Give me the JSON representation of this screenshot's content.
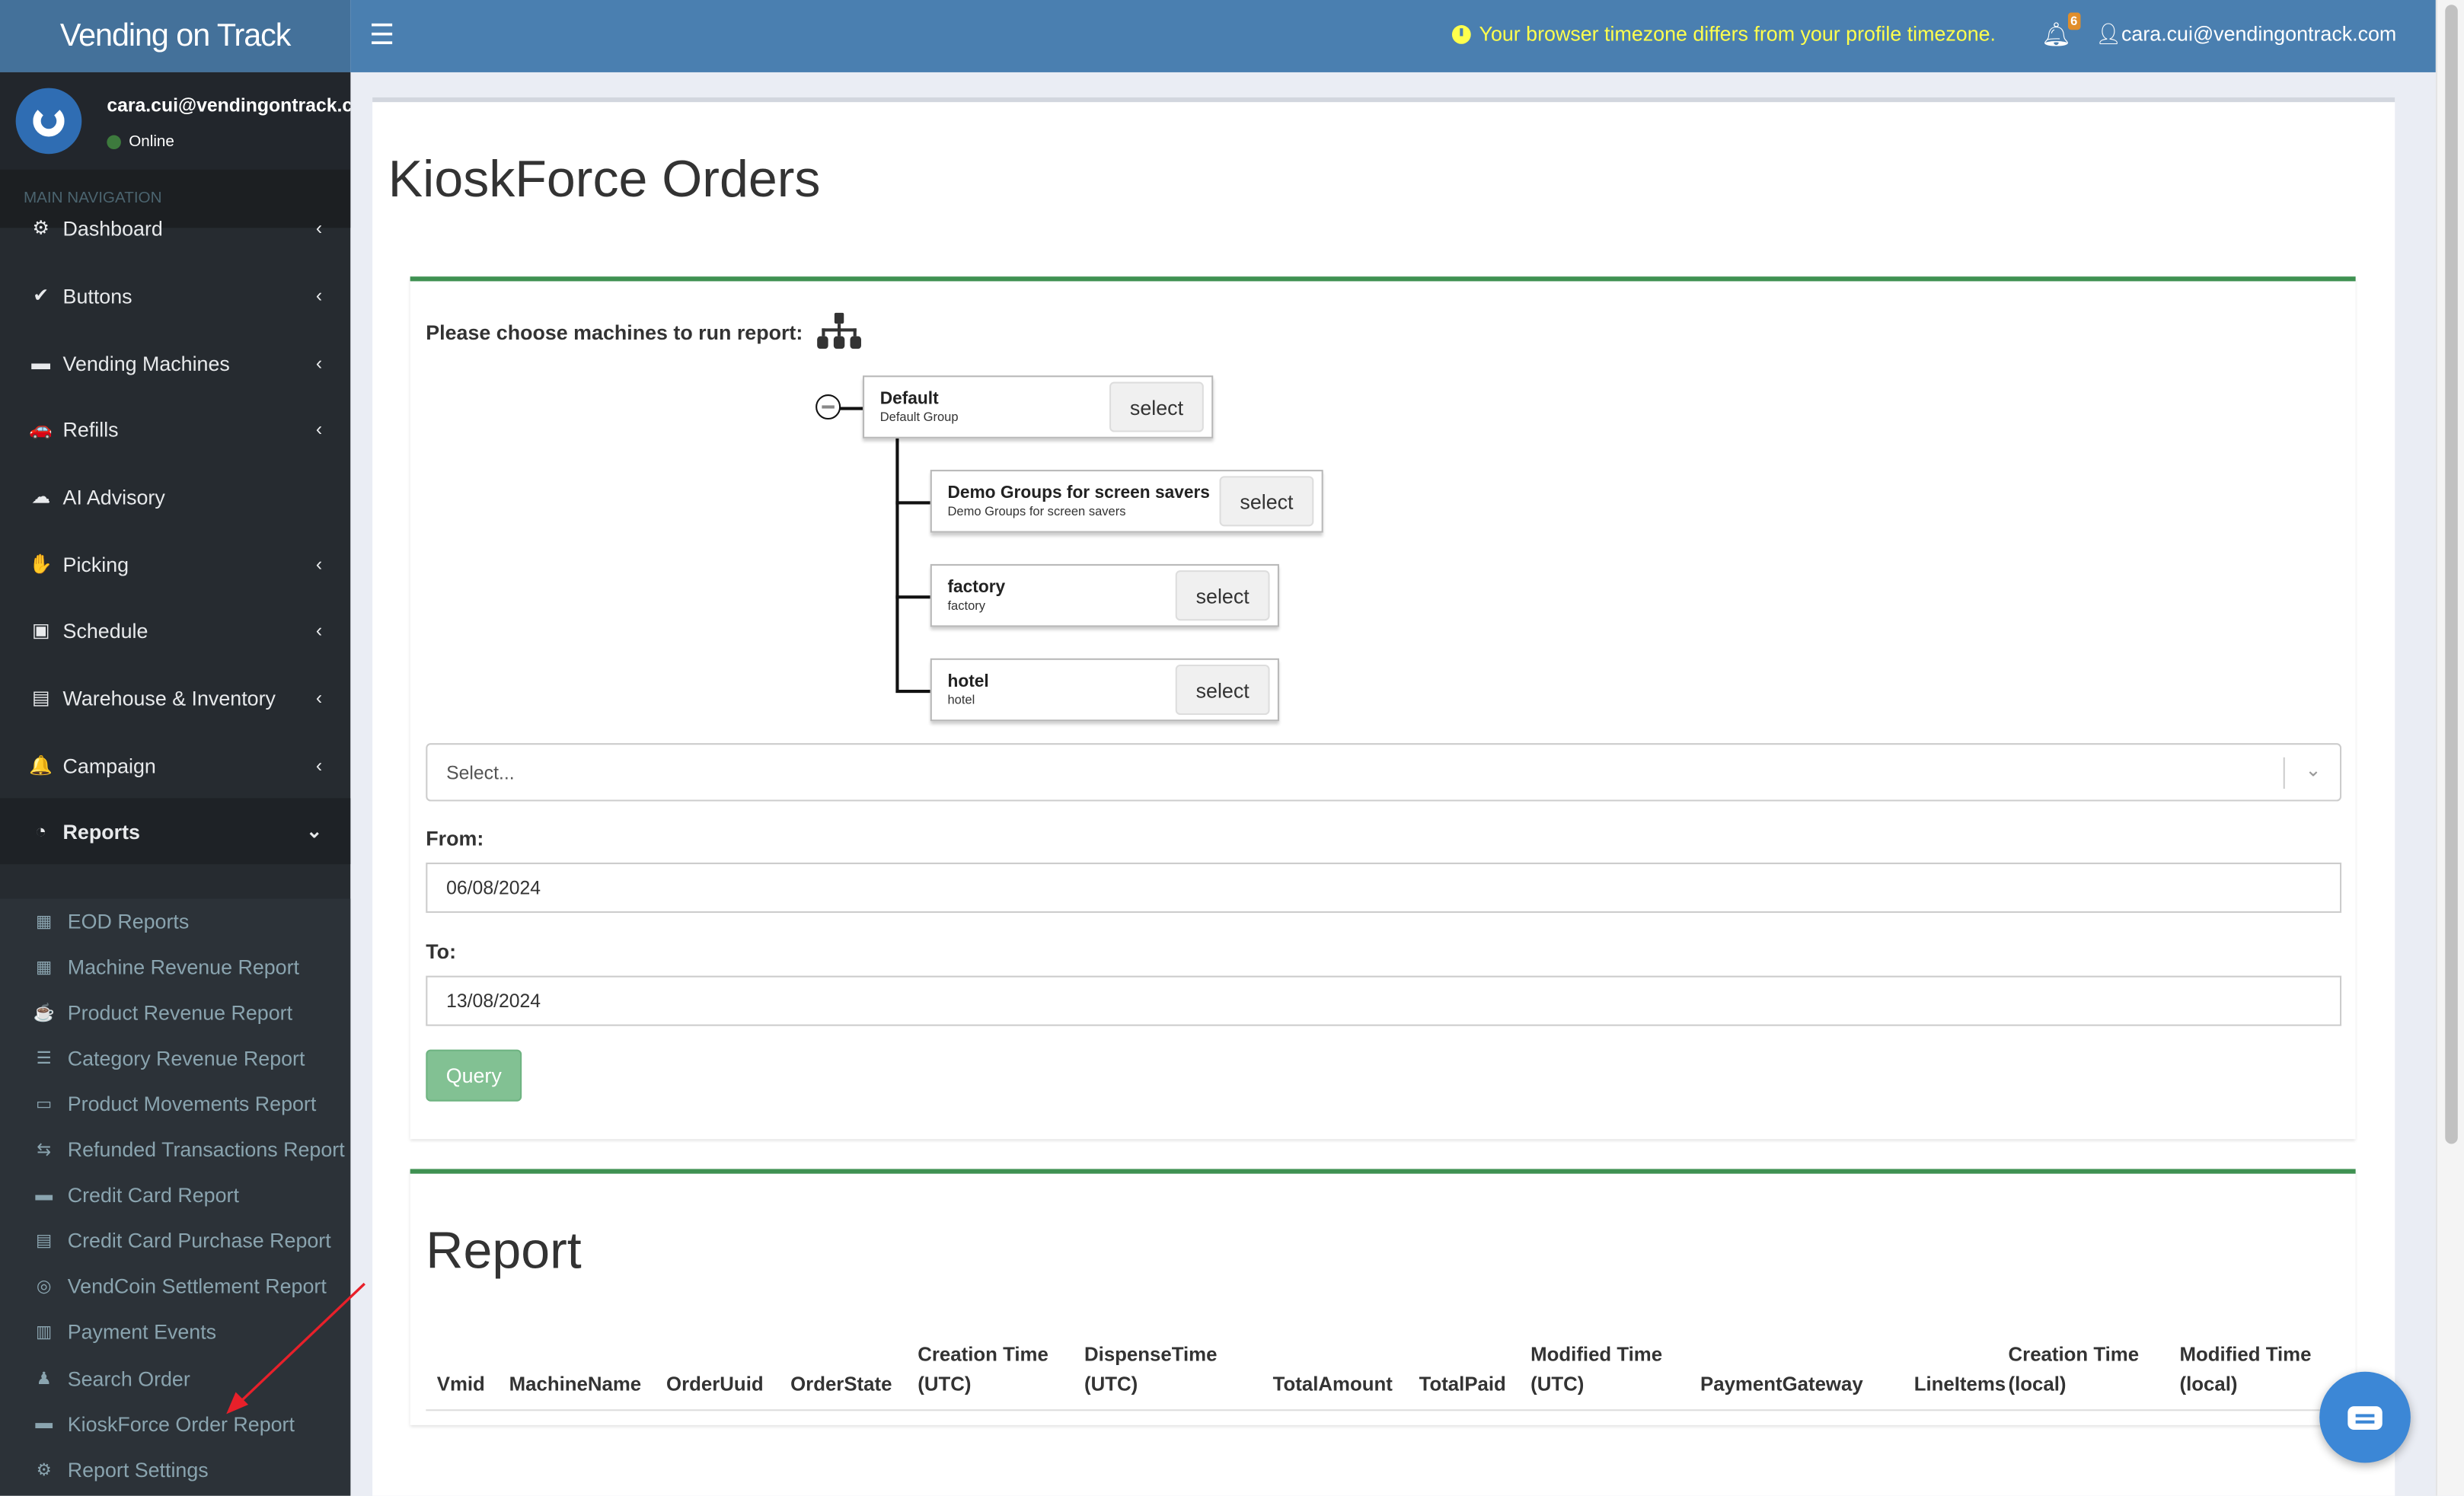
{
  "app": {
    "title": "Vending on Track"
  },
  "header": {
    "tz_warning": "Your browser timezone differs from your profile timezone.",
    "notif_count": "6",
    "user": "cara.cui@vendingontrack.com"
  },
  "user_panel": {
    "name": "cara.cui@vendingontrack.com",
    "status": "Online"
  },
  "sidebar": {
    "header": "MAIN NAVIGATION",
    "items": [
      {
        "label": "Dashboard",
        "icon": "⚙"
      },
      {
        "label": "Buttons",
        "icon": "✔"
      },
      {
        "label": "Vending Machines",
        "icon": "▬"
      },
      {
        "label": "Refills",
        "icon": "🚗"
      },
      {
        "label": "AI Advisory",
        "icon": "☁"
      },
      {
        "label": "Picking",
        "icon": "✋"
      },
      {
        "label": "Schedule",
        "icon": "▣"
      },
      {
        "label": "Warehouse & Inventory",
        "icon": "▤"
      },
      {
        "label": "Campaign",
        "icon": "🔔"
      },
      {
        "label": "Reports",
        "icon": "◔"
      }
    ],
    "report_items": [
      {
        "label": "EOD Reports",
        "icon": "▦"
      },
      {
        "label": "Machine Revenue Report",
        "icon": "▦"
      },
      {
        "label": "Product Revenue Report",
        "icon": "☕"
      },
      {
        "label": "Category Revenue Report",
        "icon": "☰"
      },
      {
        "label": "Product Movements Report",
        "icon": "▭"
      },
      {
        "label": "Refunded Transactions Report",
        "icon": "⇆"
      },
      {
        "label": "Credit Card Report",
        "icon": "▬"
      },
      {
        "label": "Credit Card Purchase Report",
        "icon": "▤"
      },
      {
        "label": "VendCoin Settlement Report",
        "icon": "◎"
      },
      {
        "label": "Payment Events",
        "icon": "▥"
      },
      {
        "label": "Search Order",
        "icon": "♟"
      },
      {
        "label": "KioskForce Order Report",
        "icon": "▬"
      },
      {
        "label": "Report Settings",
        "icon": "⚙"
      }
    ]
  },
  "main": {
    "title": "KioskForce Orders",
    "choose_label": "Please choose machines to run report:",
    "tree": [
      {
        "name": "Default",
        "desc": "Default Group",
        "button": "select"
      },
      {
        "name": "Demo Groups for screen savers",
        "desc": "Demo Groups for screen savers",
        "button": "select"
      },
      {
        "name": "factory",
        "desc": "factory",
        "button": "select"
      },
      {
        "name": "hotel",
        "desc": "hotel",
        "button": "select"
      }
    ],
    "machine_select": {
      "placeholder": "Select..."
    },
    "from": {
      "label": "From:",
      "value": "06/08/2024"
    },
    "to": {
      "label": "To:",
      "value": "13/08/2024"
    },
    "query_label": "Query"
  },
  "report": {
    "title": "Report",
    "columns": [
      "Vmid",
      "MachineName",
      "OrderUuid",
      "OrderState",
      "Creation Time (UTC)",
      "DispenseTime (UTC)",
      "TotalAmount",
      "TotalPaid",
      "Modified Time (UTC)",
      "PaymentGateway",
      "LineItems",
      "Creation Time (local)",
      "Modified Time (local)"
    ]
  }
}
